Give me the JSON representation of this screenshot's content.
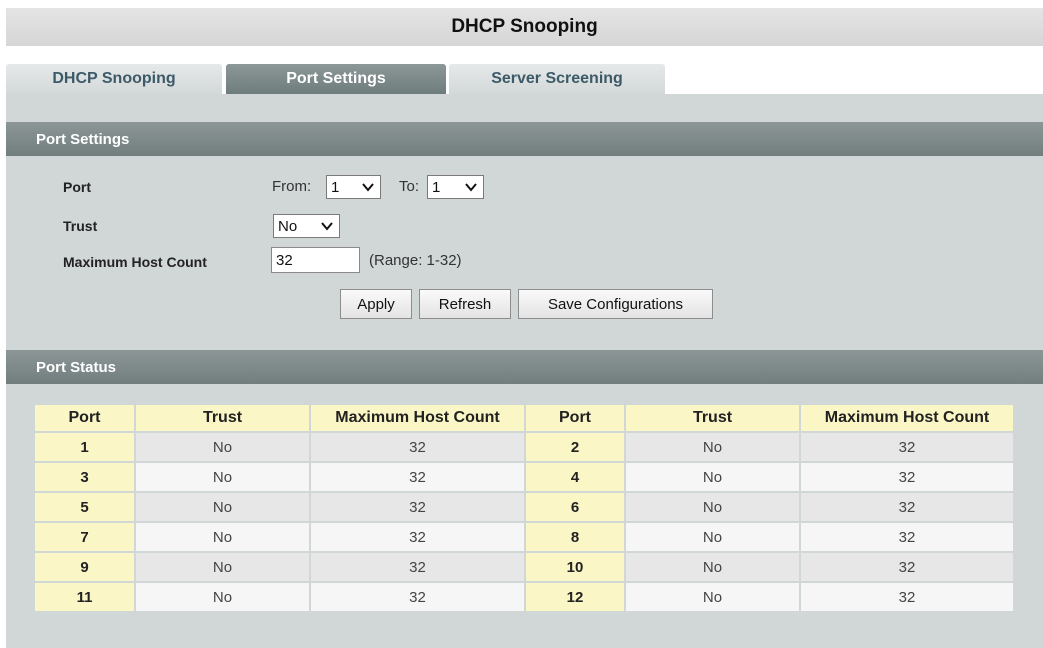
{
  "page": {
    "title": "DHCP Snooping"
  },
  "tabs": [
    {
      "label": "DHCP Snooping"
    },
    {
      "label": "Port Settings",
      "active": true
    },
    {
      "label": "Server Screening"
    }
  ],
  "port_settings": {
    "header": "Port Settings",
    "port_label": "Port",
    "from_label": "From:",
    "from_value": "1",
    "to_label": "To:",
    "to_value": "1",
    "trust_label": "Trust",
    "trust_value": "No",
    "max_host_label": "Maximum Host Count",
    "max_host_value": "32",
    "range_hint": "(Range: 1-32)",
    "buttons": {
      "apply": "Apply",
      "refresh": "Refresh",
      "save": "Save Configurations"
    }
  },
  "port_status": {
    "header": "Port Status",
    "columns": [
      "Port",
      "Trust",
      "Maximum Host Count",
      "Port",
      "Trust",
      "Maximum Host Count"
    ],
    "rows": [
      [
        "1",
        "No",
        "32",
        "2",
        "No",
        "32"
      ],
      [
        "3",
        "No",
        "32",
        "4",
        "No",
        "32"
      ],
      [
        "5",
        "No",
        "32",
        "6",
        "No",
        "32"
      ],
      [
        "7",
        "No",
        "32",
        "8",
        "No",
        "32"
      ],
      [
        "9",
        "No",
        "32",
        "10",
        "No",
        "32"
      ],
      [
        "11",
        "No",
        "32",
        "12",
        "No",
        "32"
      ]
    ]
  },
  "colors": {
    "header_bar": "#7f8a8a",
    "active_tab": "#7e8a8a",
    "panel_bg": "#d1d6d6",
    "table_header": "#fbf6c6"
  }
}
